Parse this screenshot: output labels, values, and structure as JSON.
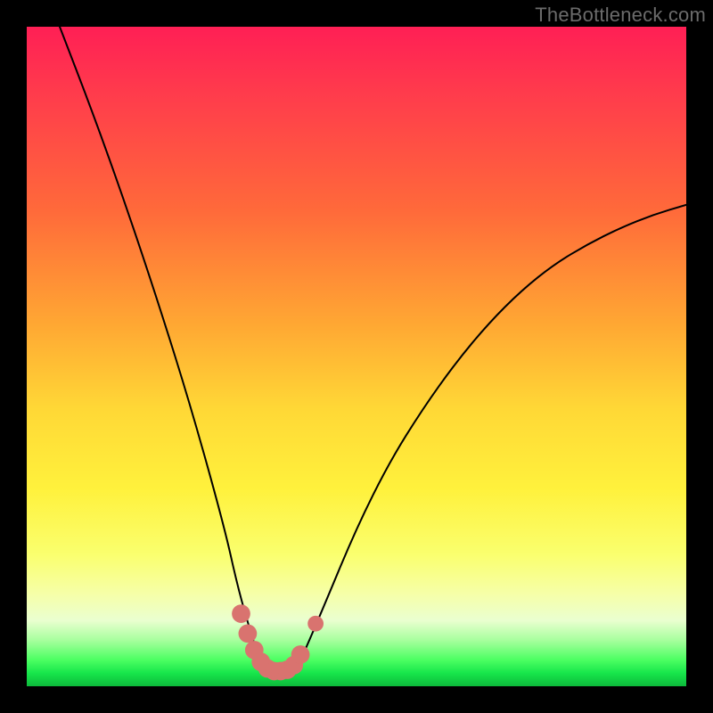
{
  "watermark": "TheBottleneck.com",
  "chart_data": {
    "type": "line",
    "title": "",
    "xlabel": "",
    "ylabel": "",
    "xlim": [
      0,
      100
    ],
    "ylim": [
      0,
      100
    ],
    "series": [
      {
        "name": "bottleneck-curve",
        "x": [
          5,
          10,
          15,
          20,
          25,
          30,
          32,
          34,
          35,
          36,
          37,
          38,
          39,
          40,
          41,
          42,
          45,
          50,
          55,
          60,
          65,
          70,
          75,
          80,
          85,
          90,
          95,
          100
        ],
        "values": [
          100,
          87,
          73,
          58,
          42,
          24,
          15,
          8,
          5,
          3,
          2,
          2,
          2,
          2,
          3,
          5,
          12,
          24,
          34,
          42,
          49,
          55,
          60,
          64,
          67,
          69.5,
          71.5,
          73
        ]
      }
    ],
    "markers": {
      "name": "highlight-dots",
      "color": "#d9736f",
      "points": [
        {
          "x": 32.5,
          "y": 11,
          "r": 1.4
        },
        {
          "x": 33.5,
          "y": 8,
          "r": 1.4
        },
        {
          "x": 34.5,
          "y": 5.5,
          "r": 1.4
        },
        {
          "x": 35.5,
          "y": 3.7,
          "r": 1.4
        },
        {
          "x": 36.5,
          "y": 2.7,
          "r": 1.4
        },
        {
          "x": 37.5,
          "y": 2.3,
          "r": 1.4
        },
        {
          "x": 38.5,
          "y": 2.3,
          "r": 1.4
        },
        {
          "x": 39.5,
          "y": 2.5,
          "r": 1.4
        },
        {
          "x": 40.5,
          "y": 3.2,
          "r": 1.4
        },
        {
          "x": 41.5,
          "y": 4.8,
          "r": 1.4
        },
        {
          "x": 43.8,
          "y": 9.5,
          "r": 1.2
        }
      ]
    }
  }
}
